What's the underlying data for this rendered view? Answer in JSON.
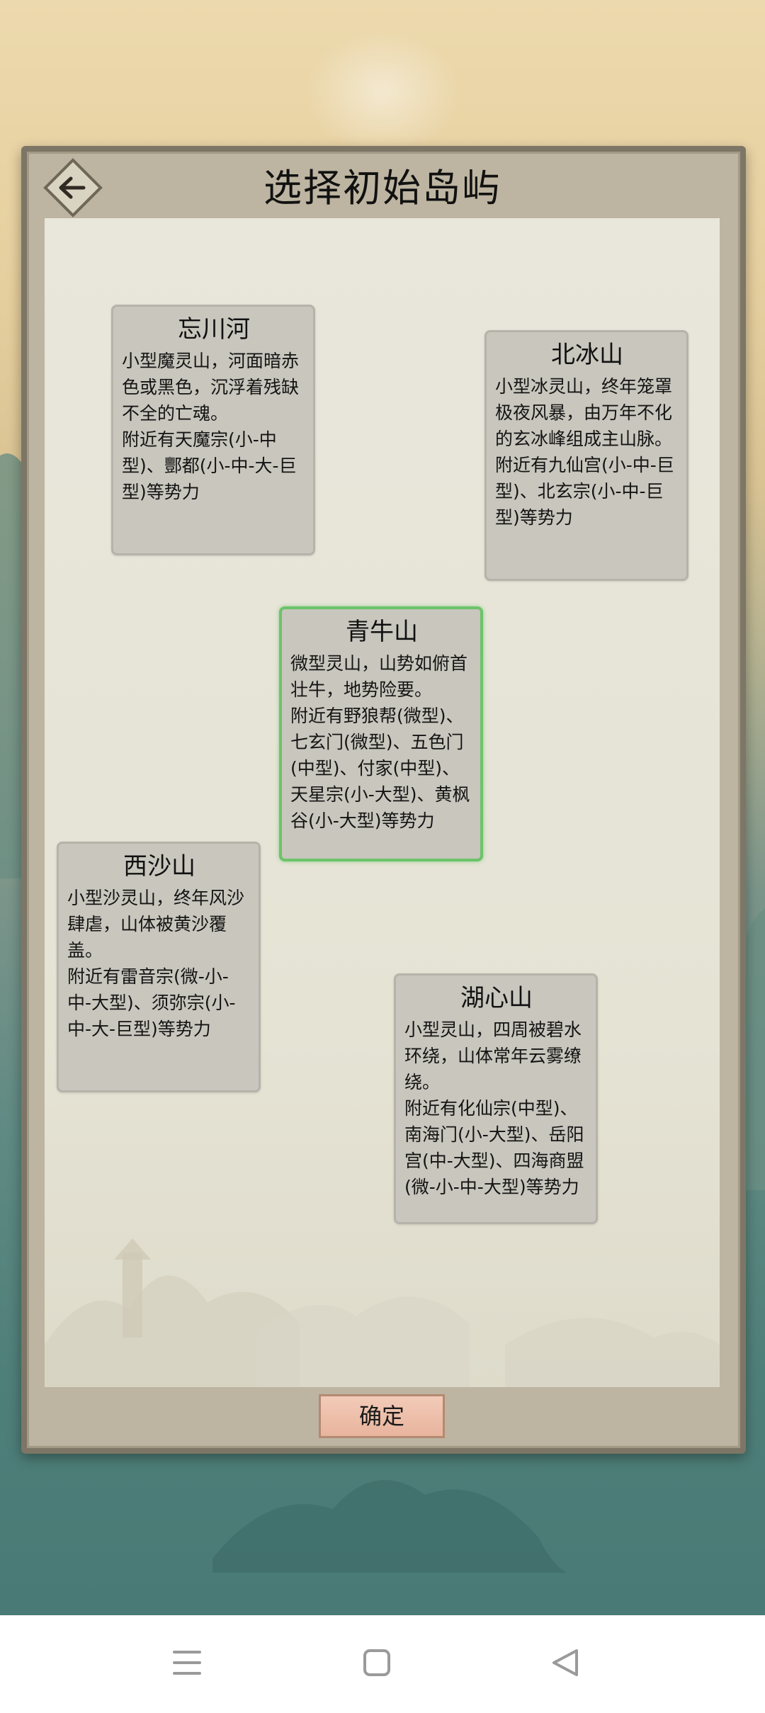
{
  "header": {
    "title": "选择初始岛屿",
    "back_icon": "back-arrow-icon"
  },
  "islands": [
    {
      "name": "忘川河",
      "desc": "小型魔灵山，河面暗赤色或黑色，沉浮着残缺不全的亡魂。",
      "factions": "附近有天魔宗(小-中型)、酆都(小-中-大-巨型)等势力",
      "selected": false
    },
    {
      "name": "北冰山",
      "desc": "小型冰灵山，终年笼罩极夜风暴，由万年不化的玄冰峰组成主山脉。",
      "factions": "附近有九仙宫(小-中-巨型)、北玄宗(小-中-巨型)等势力",
      "selected": false
    },
    {
      "name": "青牛山",
      "desc": "微型灵山，山势如俯首壮牛，地势险要。",
      "factions": "附近有野狼帮(微型)、七玄门(微型)、五色门(中型)、付家(中型)、天星宗(小-大型)、黄枫谷(小-大型)等势力",
      "selected": true
    },
    {
      "name": "西沙山",
      "desc": "小型沙灵山，终年风沙肆虐，山体被黄沙覆盖。",
      "factions": "附近有雷音宗(微-小-中-大型)、须弥宗(小-中-大-巨型)等势力",
      "selected": false
    },
    {
      "name": "湖心山",
      "desc": "小型灵山，四周被碧水环绕，山体常年云雾缭绕。",
      "factions": "附近有化仙宗(中型)、南海门(小-大型)、岳阳宫(中-大型)、四海商盟(微-小-中-大型)等势力",
      "selected": false
    }
  ],
  "footer": {
    "confirm_label": "确定"
  },
  "navbar": {
    "menu_icon": "menu-icon",
    "home_icon": "home-square-icon",
    "back_icon": "back-triangle-icon"
  },
  "colors": {
    "selected_border": "#6cc36a",
    "card_bg": "#c8c6bd",
    "confirm_bg": "#e8b49d"
  }
}
